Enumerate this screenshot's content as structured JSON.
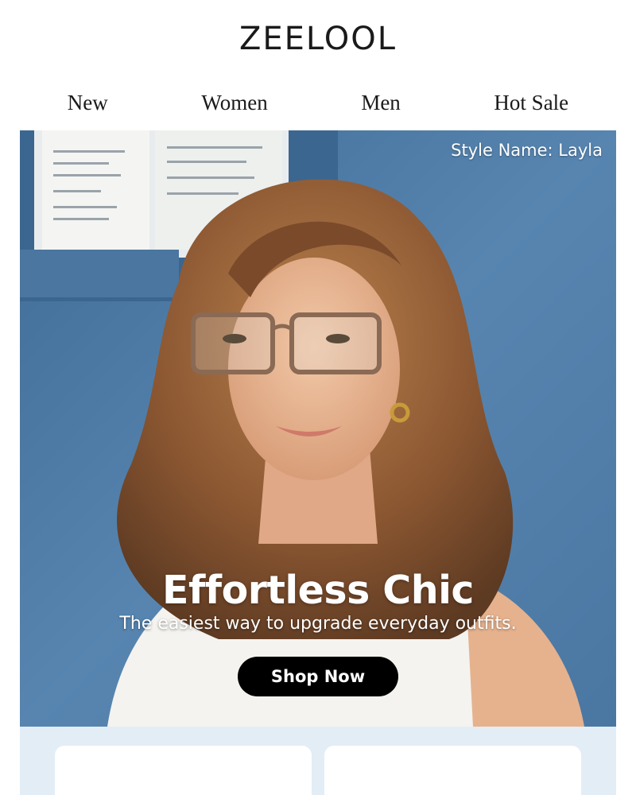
{
  "brand": {
    "logo_text": "ZEELOOL"
  },
  "nav": {
    "items": [
      {
        "label": "New"
      },
      {
        "label": "Women"
      },
      {
        "label": "Men"
      },
      {
        "label": "Hot Sale"
      }
    ]
  },
  "hero": {
    "style_label": "Style Name: Layla",
    "title": "Effortless Chic",
    "subtitle": "The easiest way to upgrade everyday outfits.",
    "cta_label": "Shop Now",
    "image": "woman-wearing-eyeglasses-photo",
    "colors": {
      "wall": "#4f7ca6",
      "cta_bg": "#000000",
      "text": "#ffffff"
    }
  },
  "cards": {
    "background": "#e3edf6",
    "count": 2
  }
}
